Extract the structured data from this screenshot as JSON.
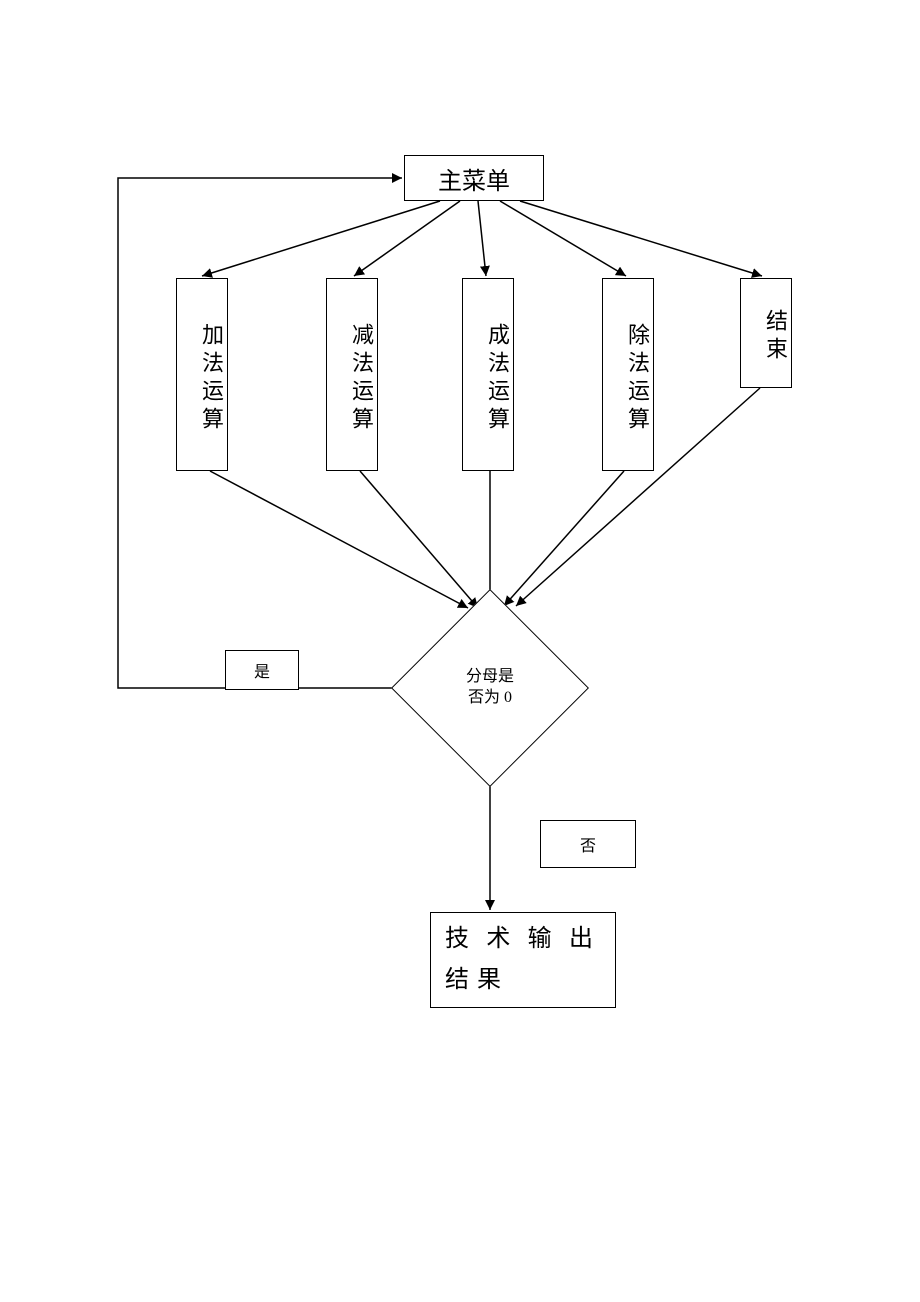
{
  "chart_data": {
    "type": "flowchart",
    "title": "",
    "nodes": [
      {
        "id": "main_menu",
        "type": "process",
        "label": "主菜单"
      },
      {
        "id": "add",
        "type": "process",
        "label": "加法运算"
      },
      {
        "id": "sub",
        "type": "process",
        "label": "减法运算"
      },
      {
        "id": "mul",
        "type": "process",
        "label": "成法运算"
      },
      {
        "id": "div",
        "type": "process",
        "label": "除法运算"
      },
      {
        "id": "end",
        "type": "process",
        "label": "结束"
      },
      {
        "id": "check_zero",
        "type": "decision",
        "label": "分母是否为 0"
      },
      {
        "id": "output",
        "type": "process",
        "label": "技术输出结果"
      }
    ],
    "edges": [
      {
        "from": "main_menu",
        "to": "add"
      },
      {
        "from": "main_menu",
        "to": "sub"
      },
      {
        "from": "main_menu",
        "to": "mul"
      },
      {
        "from": "main_menu",
        "to": "div"
      },
      {
        "from": "main_menu",
        "to": "end"
      },
      {
        "from": "add",
        "to": "check_zero"
      },
      {
        "from": "sub",
        "to": "check_zero"
      },
      {
        "from": "mul",
        "to": "check_zero"
      },
      {
        "from": "div",
        "to": "check_zero"
      },
      {
        "from": "end",
        "to": "check_zero"
      },
      {
        "from": "check_zero",
        "to": "main_menu",
        "label": "是"
      },
      {
        "from": "check_zero",
        "to": "output",
        "label": "否"
      }
    ]
  },
  "labels": {
    "main_menu": "主菜单",
    "add": "加法运算",
    "sub": "减法运算",
    "mul": "成法运算",
    "div": "除法运算",
    "end": "结束",
    "decision": "分母是\n否为 0",
    "yes": "是",
    "no": "否",
    "output": "技术输出结果"
  }
}
